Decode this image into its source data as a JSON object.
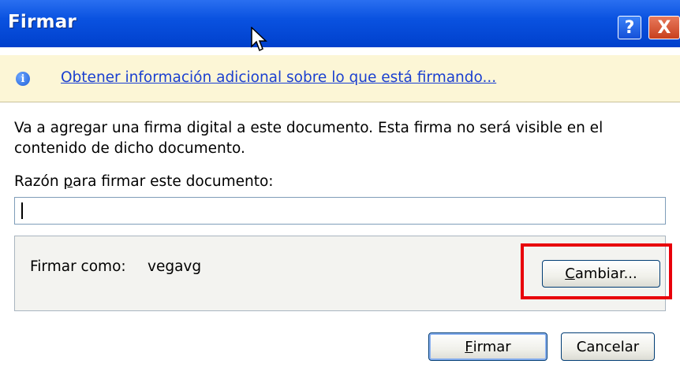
{
  "window": {
    "title": "Firmar",
    "help_glyph": "?",
    "close_glyph": "X"
  },
  "info_bar": {
    "icon_letter": "i",
    "link_text": "Obtener información adicional sobre lo que está firmando..."
  },
  "description": "Va a agregar una firma digital a este documento. Esta firma no será visible en el contenido de dicho documento.",
  "reason": {
    "label_prefix": "Razón ",
    "label_accel": "p",
    "label_suffix": "ara firmar este documento:",
    "value": ""
  },
  "signing": {
    "label": "Firmar como:",
    "value": "vegavg",
    "change_accel": "C",
    "change_rest": "ambiar..."
  },
  "buttons": {
    "sign_accel": "F",
    "sign_rest": "irmar",
    "cancel": "Cancelar"
  },
  "highlight_color": "#e8000a"
}
